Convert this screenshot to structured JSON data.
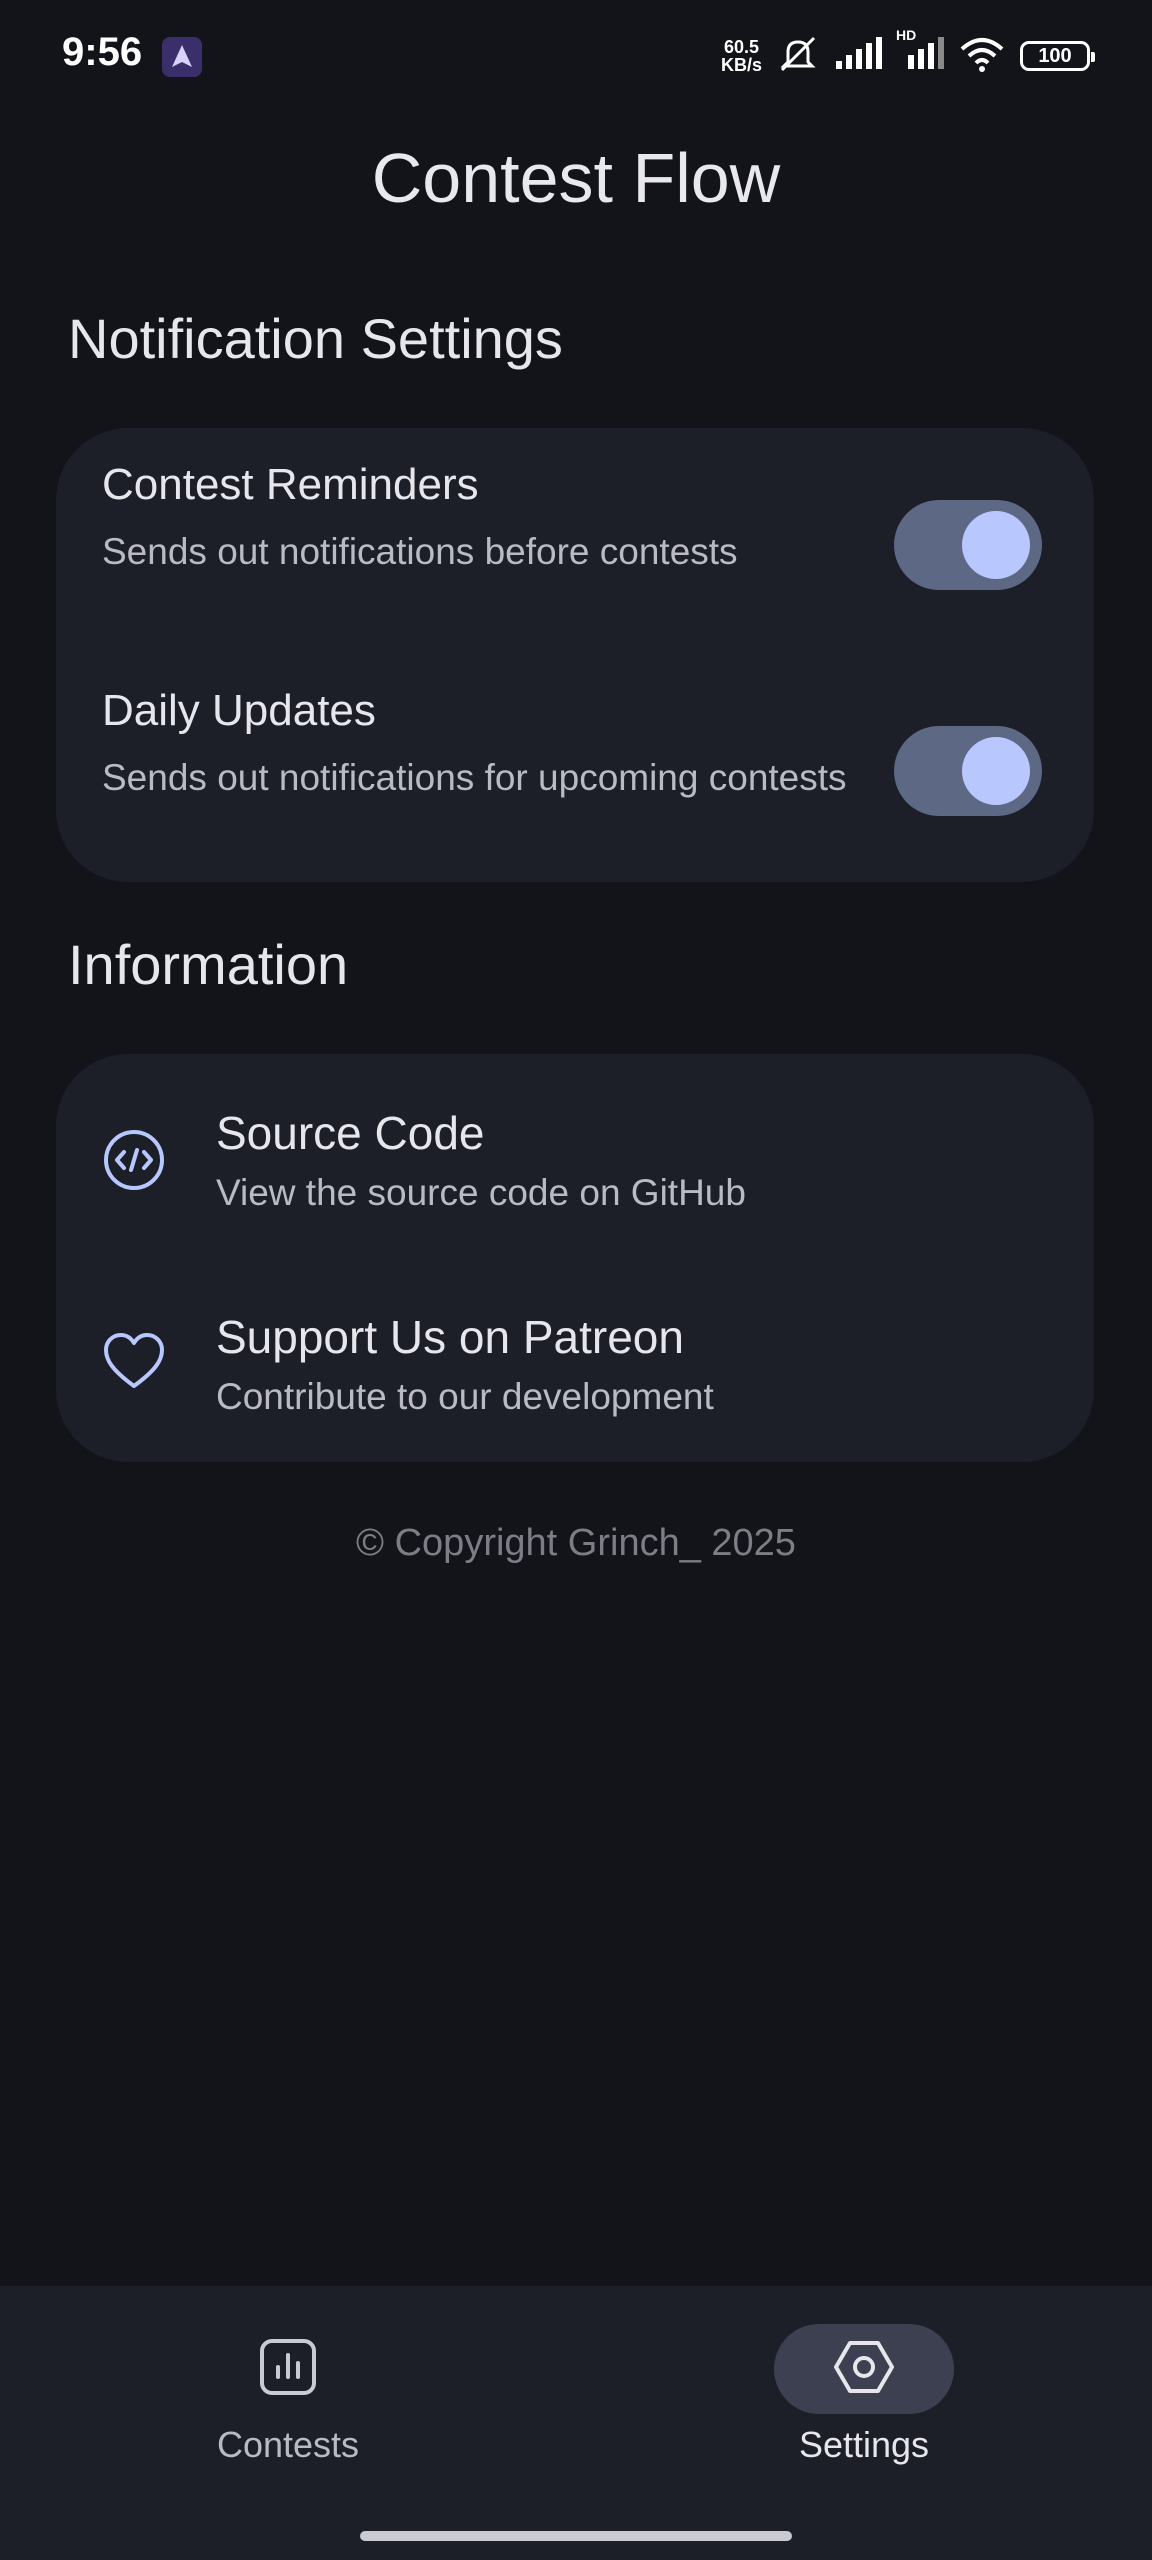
{
  "status_bar": {
    "time": "9:56",
    "net_speed_value": "60.5",
    "net_speed_unit": "KB/s",
    "network_label": "HD",
    "battery": "100"
  },
  "app": {
    "title": "Contest Flow"
  },
  "notification_settings": {
    "section_title": "Notification Settings",
    "items": [
      {
        "title": "Contest Reminders",
        "description": "Sends out notifications before contests",
        "enabled": true
      },
      {
        "title": "Daily Updates",
        "description": "Sends out notifications for upcoming contests",
        "enabled": true
      }
    ]
  },
  "information": {
    "section_title": "Information",
    "items": [
      {
        "icon": "code-icon",
        "title": "Source Code",
        "description": "View the source code on GitHub"
      },
      {
        "icon": "heart-icon",
        "title": "Support Us on Patreon",
        "description": "Contribute to our development"
      }
    ]
  },
  "footer": {
    "copyright": "© Copyright Grinch_ 2025"
  },
  "bottom_nav": {
    "items": [
      {
        "label": "Contests",
        "icon": "chart-icon",
        "active": false
      },
      {
        "label": "Settings",
        "icon": "settings-hexagon-icon",
        "active": true
      }
    ]
  },
  "colors": {
    "background": "#131419",
    "card": "#1d1f28",
    "toggle_track": "#5d6885",
    "toggle_knob": "#b8c8ff",
    "accent_icon": "#b8c8ff"
  }
}
